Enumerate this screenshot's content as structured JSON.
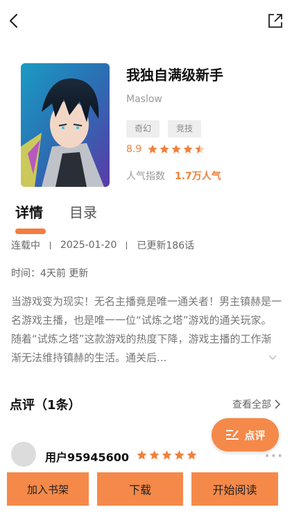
{
  "book": {
    "title": "我独自满级新手",
    "author": "Maslow",
    "tags": [
      "奇幻",
      "竞技"
    ],
    "rating": "8.9",
    "rating_stars": 4.5,
    "popularity_label": "人气指数",
    "popularity_value": "1.7万人气"
  },
  "tabs": [
    {
      "label": "详情",
      "active": true
    },
    {
      "label": "目录",
      "active": false
    }
  ],
  "meta": {
    "status": "连载中",
    "date": "2025-01-20",
    "update": "已更新186话",
    "time": "时间：4天前 更新"
  },
  "description": "当游戏变为现实！无名主播竟是唯一通关者！男主镇赫是一名游戏主播，也是唯一一位“试炼之塔”游戏的通关玩家。随着“试炼之塔”这款游戏的热度下降，游戏主播的工作渐渐无法维持镇赫的生活。通关后...",
  "reviews": {
    "title": "点评（1条）",
    "view_all": "查看全部",
    "fab_label": "点评",
    "items": [
      {
        "user": "用户95945600",
        "stars": 5
      }
    ]
  },
  "actions": {
    "add_shelf": "加入书架",
    "download": "下载",
    "start_read": "开始阅读"
  },
  "colors": {
    "accent": "#f5894a",
    "accent_text": "#f0813a"
  }
}
